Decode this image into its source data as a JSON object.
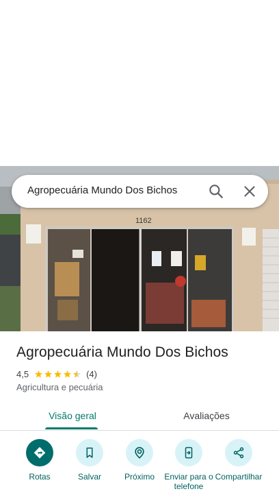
{
  "search": {
    "query": "Agropecuária Mundo Dos Bichos"
  },
  "place": {
    "name": "Agropecuária Mundo Dos Bichos",
    "rating": "4,5",
    "stars": 4.5,
    "review_count": "(4)",
    "category": "Agricultura e pecuária",
    "storefront_number": "1162"
  },
  "tabs": [
    {
      "label": "Visão geral",
      "active": true
    },
    {
      "label": "Avaliações",
      "active": false
    }
  ],
  "actions": [
    {
      "label": "Rotas",
      "icon": "directions-icon"
    },
    {
      "label": "Salvar",
      "icon": "bookmark-icon"
    },
    {
      "label": "Próximo",
      "icon": "nearby-icon"
    },
    {
      "label": "Enviar para o telefone",
      "icon": "send-to-phone-icon"
    },
    {
      "label": "Compartilhar",
      "icon": "share-icon"
    }
  ],
  "colors": {
    "accent": "#00796b",
    "star": "#fbbc04",
    "action_bg": "#d7f3f8",
    "primary_action": "#006d6d"
  }
}
